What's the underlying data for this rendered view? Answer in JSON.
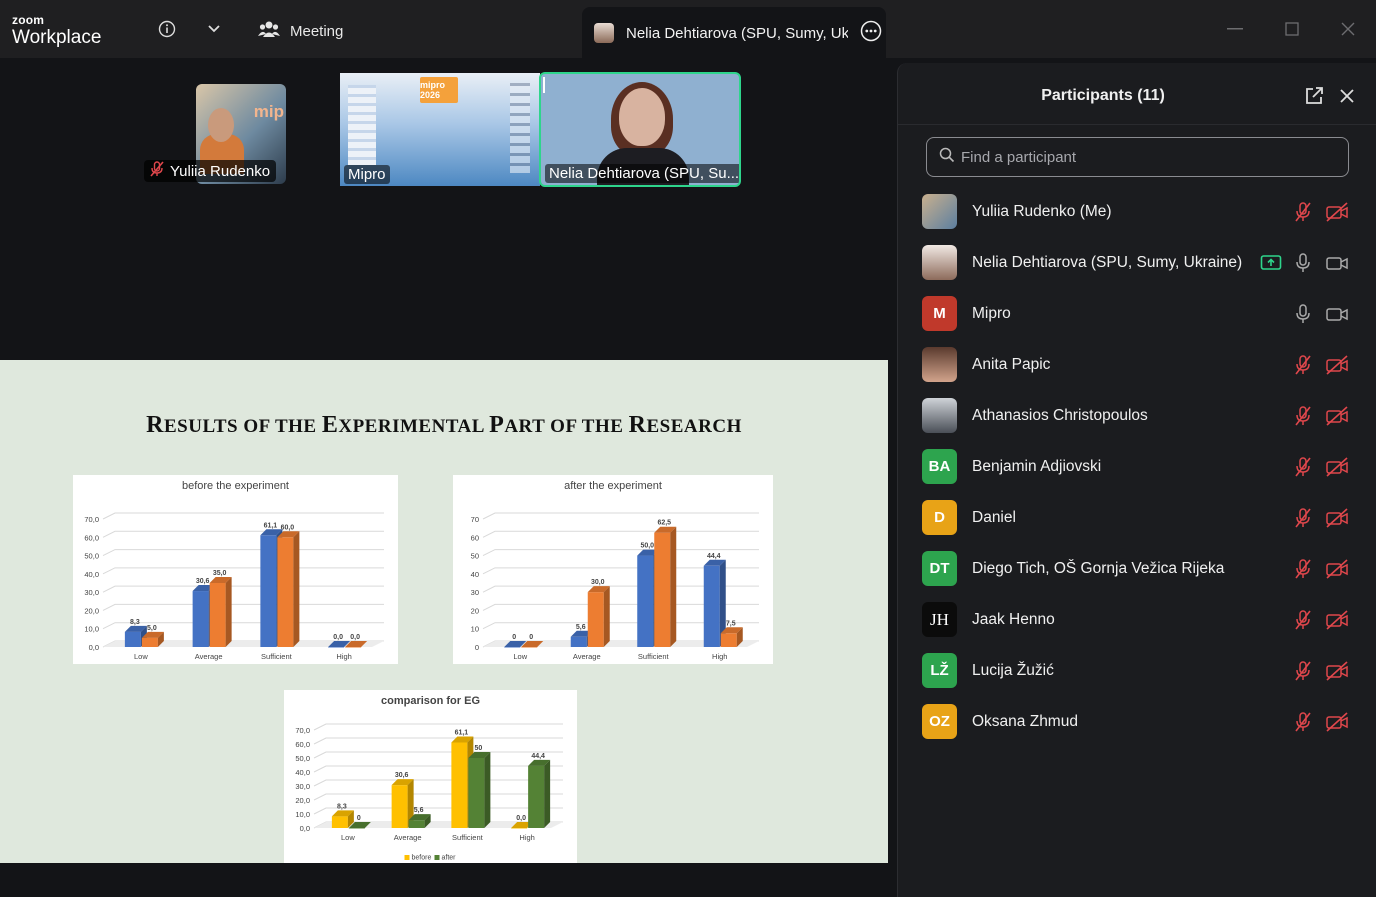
{
  "app": {
    "logo_top": "zoom",
    "logo_bottom": "Workplace",
    "meeting_tab_label": "Meeting",
    "active_tab_title": "Nelia Dehtiarova (SPU, Sumy, Ukr"
  },
  "video_strip": {
    "tiles": [
      {
        "name": "Yuliia Rudenko",
        "muted": true
      },
      {
        "name": "Mipro",
        "muted": false
      },
      {
        "name": "Nelia Dehtiarova (SPU, Su...",
        "muted": false,
        "speaking": true
      }
    ],
    "mipro_logo": "mipro 2026",
    "yuliia_bg_text": "mip"
  },
  "slide": {
    "title_parts": [
      {
        "big": "R",
        "small": "ESULTS OF THE "
      },
      {
        "big": "E",
        "small": "XPERIMENTAL "
      },
      {
        "big": "P",
        "small": "ART OF THE "
      },
      {
        "big": "R",
        "small": "ESEARCH"
      }
    ]
  },
  "chart_data": [
    {
      "type": "bar",
      "title": "before  the experiment",
      "categories": [
        "Low",
        "Average",
        "Sufficient",
        "High"
      ],
      "series": [
        {
          "values": [
            8.3,
            30.6,
            61.1,
            0.0
          ],
          "color": "#4472C4"
        },
        {
          "values": [
            5.0,
            35.0,
            60.0,
            0.0
          ],
          "color": "#ED7D31"
        }
      ],
      "data_labels": [
        [
          "8,3",
          "30,6",
          "61,1",
          "0,0"
        ],
        [
          "5,0",
          "35,0",
          "60,0",
          "0,0"
        ]
      ],
      "ytick_labels": [
        "0,0",
        "10,0",
        "20,0",
        "30,0",
        "40,0",
        "50,0",
        "60,0",
        "70,0"
      ],
      "ylim": [
        0,
        70
      ]
    },
    {
      "type": "bar",
      "title": "after the experiment",
      "categories": [
        "Low",
        "Average",
        "Sufficient",
        "High"
      ],
      "series": [
        {
          "values": [
            0,
            5.6,
            50.0,
            44.4
          ],
          "color": "#4472C4"
        },
        {
          "values": [
            0,
            30.0,
            62.5,
            7.5
          ],
          "color": "#ED7D31"
        }
      ],
      "data_labels": [
        [
          "0",
          "5,6",
          "50,0",
          "44,4"
        ],
        [
          "0",
          "30,0",
          "62,5",
          "7,5"
        ]
      ],
      "ytick_labels": [
        "0",
        "10",
        "20",
        "30",
        "40",
        "50",
        "60",
        "70"
      ],
      "ylim": [
        0,
        70
      ]
    },
    {
      "type": "bar",
      "title": "comparison for EG",
      "categories": [
        "Low",
        "Average",
        "Sufficient",
        "High"
      ],
      "series": [
        {
          "name": "before",
          "values": [
            8.3,
            30.6,
            61.1,
            0.0
          ],
          "color": "#FFC000"
        },
        {
          "name": "after",
          "values": [
            0,
            5.6,
            50,
            44.4
          ],
          "color": "#548235"
        }
      ],
      "data_labels": [
        [
          "8,3",
          "30,6",
          "61,1",
          "0,0"
        ],
        [
          "0",
          "5,6",
          "50",
          "44,4"
        ]
      ],
      "ytick_labels": [
        "0,0",
        "10,0",
        "20,0",
        "30,0",
        "40,0",
        "50,0",
        "60,0",
        "70,0"
      ],
      "ylim": [
        0,
        70
      ],
      "legend": "bottom"
    }
  ],
  "participants_panel": {
    "title": "Participants (11)",
    "search_placeholder": "Find a participant",
    "participants": [
      {
        "name": "Yuliia Rudenko (Me)",
        "initials": "",
        "avatar": "photo",
        "mic": "muted",
        "video": "off"
      },
      {
        "name": "Nelia Dehtiarova (SPU, Sumy, Ukraine)",
        "initials": "",
        "avatar": "photo",
        "sharing": true,
        "mic": "on",
        "video": "on"
      },
      {
        "name": "Mipro",
        "initials": "M",
        "color": "#C0392B",
        "mic": "on",
        "video": "on"
      },
      {
        "name": "Anita Papic",
        "initials": "",
        "avatar": "photo",
        "mic": "muted",
        "video": "off"
      },
      {
        "name": "Athanasios Christopoulos",
        "initials": "",
        "avatar": "photo",
        "mic": "muted",
        "video": "off"
      },
      {
        "name": "Benjamin Adjiovski",
        "initials": "BA",
        "color": "#2DA44E",
        "mic": "muted",
        "video": "off"
      },
      {
        "name": "Daniel",
        "initials": "D",
        "color": "#E8A317",
        "mic": "muted",
        "video": "off"
      },
      {
        "name": "Diego Tich, OŠ Gornja Vežica Rijeka",
        "initials": "DT",
        "color": "#2DA44E",
        "mic": "muted",
        "video": "off"
      },
      {
        "name": "Jaak Henno",
        "initials": "JH",
        "avatar": "logo",
        "mic": "muted",
        "video": "off"
      },
      {
        "name": "Lucija Žužić",
        "initials": "LŽ",
        "color": "#2DA44E",
        "mic": "muted",
        "video": "off"
      },
      {
        "name": "Oksana Zhmud",
        "initials": "OZ",
        "color": "#E8A317",
        "mic": "muted",
        "video": "off"
      }
    ]
  },
  "colors": {
    "accent_green": "#2ED58C",
    "muted_red": "#E0474C",
    "panel_bg": "#1B1C1F"
  }
}
